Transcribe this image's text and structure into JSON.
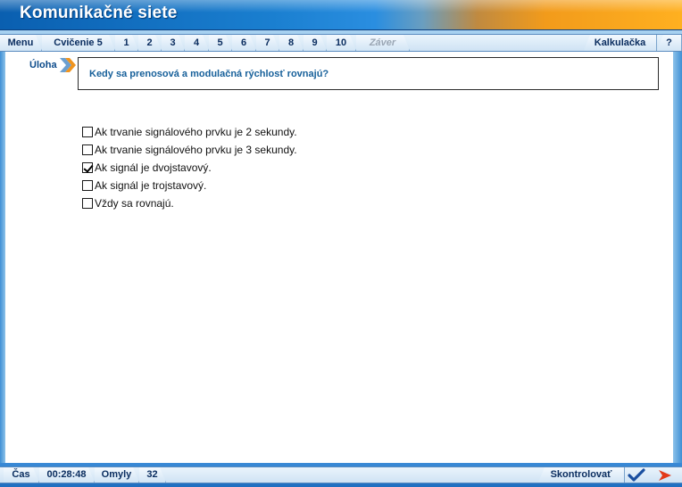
{
  "app": {
    "title": "Komunikačné siete"
  },
  "nav": {
    "menu": "Menu",
    "exercise": "Cvičenie 5",
    "pages": [
      "1",
      "2",
      "3",
      "4",
      "5",
      "6",
      "7",
      "8",
      "9",
      "10"
    ],
    "end": "Záver",
    "calculator": "Kalkulačka",
    "help": "?"
  },
  "task": {
    "label": "Úloha",
    "question": "Kedy sa prenosová a modulačná rýchlosť rovnajú?",
    "options": [
      {
        "label": "Ak trvanie signálového prvku je 2 sekundy.",
        "checked": false
      },
      {
        "label": "Ak trvanie signálového prvku je 3 sekundy.",
        "checked": false
      },
      {
        "label": "Ak signál je dvojstavový.",
        "checked": true
      },
      {
        "label": "Ak signál je trojstavový.",
        "checked": false
      },
      {
        "label": "Vždy sa rovnajú.",
        "checked": false
      }
    ]
  },
  "status": {
    "time_label": "Čas",
    "time_value": "00:28:48",
    "errors_label": "Omyly",
    "errors_value": "32",
    "check_label": "Skontrolovať"
  },
  "colors": {
    "title_blue": "#0a5fb0",
    "title_orange": "#f29b1b",
    "question_text": "#17609a",
    "nav_text": "#0b2e60"
  }
}
